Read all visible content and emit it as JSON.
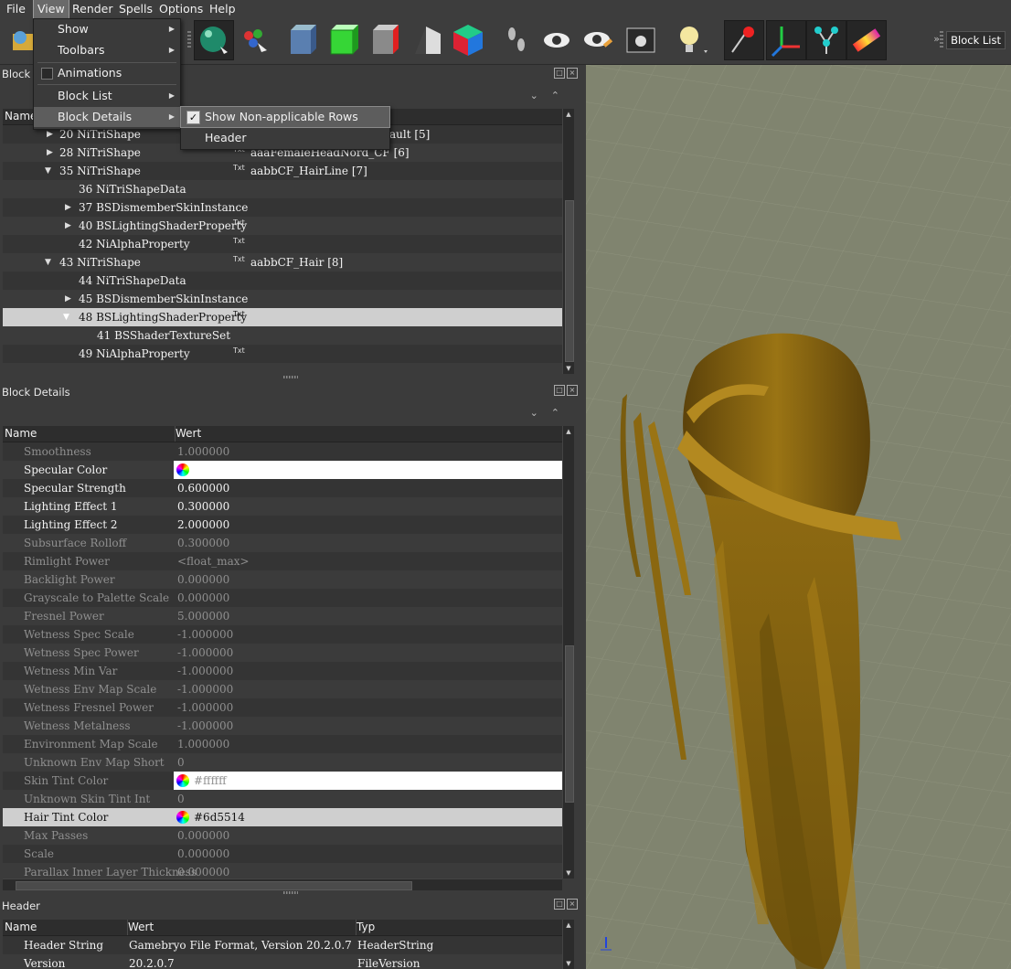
{
  "menubar": {
    "items": [
      "File",
      "View",
      "Render",
      "Spells",
      "Options",
      "Help"
    ],
    "active": "View"
  },
  "toolbar": {
    "right_button": "Block List"
  },
  "view_menu": {
    "items": [
      {
        "label": "Show",
        "submenu": true
      },
      {
        "label": "Toolbars",
        "submenu": true
      },
      {
        "label": "Animations",
        "checkable": true
      },
      {
        "label": "Block List",
        "submenu": true
      },
      {
        "label": "Block Details",
        "submenu": true,
        "highlighted": true
      }
    ],
    "block_details_submenu": [
      {
        "label": "Show Non-applicable Rows",
        "checked": true
      },
      {
        "label": "Header"
      }
    ]
  },
  "block_list": {
    "title": "Block List",
    "column_name": "Name",
    "rows": [
      {
        "name": "20 NiTriShape",
        "value": "ault [5]",
        "badge": ""
      },
      {
        "name": "28 NiTriShape",
        "value": "aaaFemaleHeadNord_CF [6]",
        "badge": "Txt"
      },
      {
        "name": "35 NiTriShape",
        "value": "aabbCF_HairLine [7]",
        "badge": "Txt"
      },
      {
        "name": "36 NiTriShapeData",
        "value": "",
        "badge": ""
      },
      {
        "name": "37 BSDismemberSkinInstance",
        "value": "",
        "badge": ""
      },
      {
        "name": "40 BSLightingShaderProperty",
        "value": "",
        "badge": "Txt"
      },
      {
        "name": "42 NiAlphaProperty",
        "value": "",
        "badge": "Txt"
      },
      {
        "name": "43 NiTriShape",
        "value": "aabbCF_Hair [8]",
        "badge": "Txt"
      },
      {
        "name": "44 NiTriShapeData",
        "value": "",
        "badge": ""
      },
      {
        "name": "45 BSDismemberSkinInstance",
        "value": "",
        "badge": ""
      },
      {
        "name": "48 BSLightingShaderProperty",
        "value": "",
        "badge": "Txt"
      },
      {
        "name": "41 BSShaderTextureSet",
        "value": "",
        "badge": ""
      },
      {
        "name": "49 NiAlphaProperty",
        "value": "",
        "badge": "Txt"
      }
    ]
  },
  "block_details": {
    "title": "Block Details",
    "columns": [
      "Name",
      "Wert"
    ],
    "rows": [
      {
        "name": "Smoothness",
        "value": "1.000000"
      },
      {
        "name": "Specular Color",
        "value": ""
      },
      {
        "name": "Specular Strength",
        "value": "0.600000"
      },
      {
        "name": "Lighting Effect 1",
        "value": "0.300000"
      },
      {
        "name": "Lighting Effect 2",
        "value": "2.000000"
      },
      {
        "name": "Subsurface Rolloff",
        "value": "0.300000"
      },
      {
        "name": "Rimlight Power",
        "value": "<float_max>"
      },
      {
        "name": "Backlight Power",
        "value": "0.000000"
      },
      {
        "name": "Grayscale to Palette Scale",
        "value": "0.000000"
      },
      {
        "name": "Fresnel Power",
        "value": "5.000000"
      },
      {
        "name": "Wetness Spec Scale",
        "value": "-1.000000"
      },
      {
        "name": "Wetness Spec Power",
        "value": "-1.000000"
      },
      {
        "name": "Wetness Min Var",
        "value": "-1.000000"
      },
      {
        "name": "Wetness Env Map Scale",
        "value": "-1.000000"
      },
      {
        "name": "Wetness Fresnel Power",
        "value": "-1.000000"
      },
      {
        "name": "Wetness Metalness",
        "value": "-1.000000"
      },
      {
        "name": "Environment Map Scale",
        "value": "1.000000"
      },
      {
        "name": "Unknown Env Map Short",
        "value": "0"
      },
      {
        "name": "Skin Tint Color",
        "value": "#ffffff"
      },
      {
        "name": "Unknown Skin Tint Int",
        "value": "0"
      },
      {
        "name": "Hair Tint Color",
        "value": "#6d5514"
      },
      {
        "name": "Max Passes",
        "value": "0.000000"
      },
      {
        "name": "Scale",
        "value": "0.000000"
      },
      {
        "name": "Parallax Inner Layer Thickness",
        "value": "0.000000"
      }
    ]
  },
  "header_panel": {
    "title": "Header",
    "columns": [
      "Name",
      "Wert",
      "Typ"
    ],
    "rows": [
      {
        "name": "Header String",
        "value": "Gamebryo File Format, Version 20.2.0.7",
        "type": "HeaderString"
      },
      {
        "name": "Version",
        "value": "20.2.0.7",
        "type": "FileVersion"
      }
    ]
  },
  "colors": {
    "hair": "#8a6410",
    "hair_tint": "#6d5514",
    "viewport_bg": "#80846f"
  }
}
